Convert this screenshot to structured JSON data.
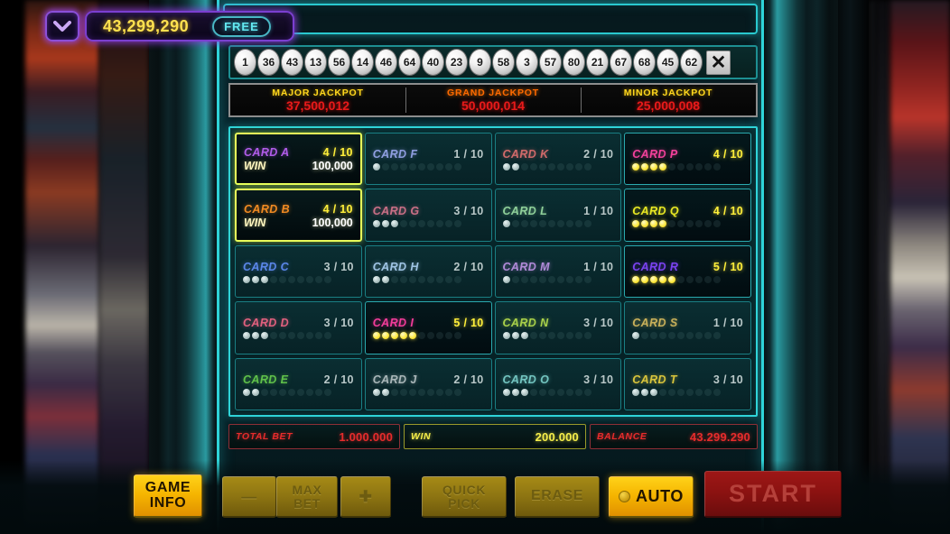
{
  "hud": {
    "chevron_icon": "chevron-down-icon",
    "balance": "43,299,290",
    "free_label": "FREE"
  },
  "balls": {
    "numbers": [
      "1",
      "36",
      "43",
      "13",
      "56",
      "14",
      "46",
      "64",
      "40",
      "23",
      "9",
      "58",
      "3",
      "57",
      "80",
      "21",
      "67",
      "68",
      "45",
      "62"
    ],
    "close_icon": "✕"
  },
  "jackpots": [
    {
      "label": "MAJOR JACKPOT",
      "value": "37,500,012",
      "style": "major"
    },
    {
      "label": "GRAND JACKPOT",
      "value": "50,000,014",
      "style": "grand"
    },
    {
      "label": "MINOR JACKPOT",
      "value": "25,000,008",
      "style": "minor"
    }
  ],
  "cards": [
    {
      "name": "CARD A",
      "count": "4 / 10",
      "marked": 4,
      "total": 10,
      "color": "#b05ce8",
      "state": "win",
      "win_label": "WIN",
      "win_value": "100,000"
    },
    {
      "name": "CARD B",
      "count": "4 / 10",
      "marked": 4,
      "total": 10,
      "color": "#f08a22",
      "state": "win",
      "win_label": "WIN",
      "win_value": "100,000"
    },
    {
      "name": "CARD C",
      "count": "3 / 10",
      "marked": 3,
      "total": 10,
      "color": "#5a86e8",
      "state": "normal"
    },
    {
      "name": "CARD D",
      "count": "3 / 10",
      "marked": 3,
      "total": 10,
      "color": "#e0607e",
      "state": "normal"
    },
    {
      "name": "CARD E",
      "count": "2 / 10",
      "marked": 2,
      "total": 10,
      "color": "#5fc04a",
      "state": "normal"
    },
    {
      "name": "CARD F",
      "count": "1 / 10",
      "marked": 1,
      "total": 10,
      "color": "#8f9ee0",
      "state": "normal"
    },
    {
      "name": "CARD G",
      "count": "3 / 10",
      "marked": 3,
      "total": 10,
      "color": "#c96f86",
      "state": "normal"
    },
    {
      "name": "CARD H",
      "count": "2 / 10",
      "marked": 2,
      "total": 10,
      "color": "#9fc4e4",
      "state": "normal"
    },
    {
      "name": "CARD I",
      "count": "5 / 10",
      "marked": 5,
      "total": 10,
      "color": "#f23c9a",
      "state": "active"
    },
    {
      "name": "CARD J",
      "count": "2 / 10",
      "marked": 2,
      "total": 10,
      "color": "#a8b6b8",
      "state": "normal"
    },
    {
      "name": "CARD K",
      "count": "2 / 10",
      "marked": 2,
      "total": 10,
      "color": "#d06a6a",
      "state": "normal"
    },
    {
      "name": "CARD L",
      "count": "1 / 10",
      "marked": 1,
      "total": 10,
      "color": "#8fd09a",
      "state": "normal"
    },
    {
      "name": "CARD M",
      "count": "1 / 10",
      "marked": 1,
      "total": 10,
      "color": "#b08ad8",
      "state": "normal"
    },
    {
      "name": "CARD N",
      "count": "3 / 10",
      "marked": 3,
      "total": 10,
      "color": "#a8d04a",
      "state": "normal"
    },
    {
      "name": "CARD O",
      "count": "3 / 10",
      "marked": 3,
      "total": 10,
      "color": "#72c4c0",
      "state": "normal"
    },
    {
      "name": "CARD P",
      "count": "4 / 10",
      "marked": 4,
      "total": 10,
      "color": "#f2409a",
      "state": "active"
    },
    {
      "name": "CARD Q",
      "count": "4 / 10",
      "marked": 4,
      "total": 10,
      "color": "#e8e824",
      "state": "active"
    },
    {
      "name": "CARD R",
      "count": "5 / 10",
      "marked": 5,
      "total": 10,
      "color": "#7a42f0",
      "state": "active"
    },
    {
      "name": "CARD S",
      "count": "1 / 10",
      "marked": 1,
      "total": 10,
      "color": "#c8b05a",
      "state": "normal"
    },
    {
      "name": "CARD T",
      "count": "3 / 10",
      "marked": 3,
      "total": 10,
      "color": "#d8c43c",
      "state": "normal"
    }
  ],
  "status": {
    "total_bet_label": "TOTAL BET",
    "total_bet_value": "1.000.000",
    "win_label": "WIN",
    "win_value": "200.000",
    "balance_label": "BALANCE",
    "balance_value": "43.299.290"
  },
  "controls": {
    "game_info_line1": "GAME",
    "game_info_line2": "INFO",
    "minus_label": "—",
    "max_bet_line1": "MAX",
    "max_bet_line2": "BET",
    "plus_label": "✚",
    "quick_pick_line1": "QUICK",
    "quick_pick_line2": "PICK",
    "erase_label": "ERASE",
    "auto_label": "AUTO",
    "auto_icon": "coin-icon",
    "start_label": "START"
  }
}
